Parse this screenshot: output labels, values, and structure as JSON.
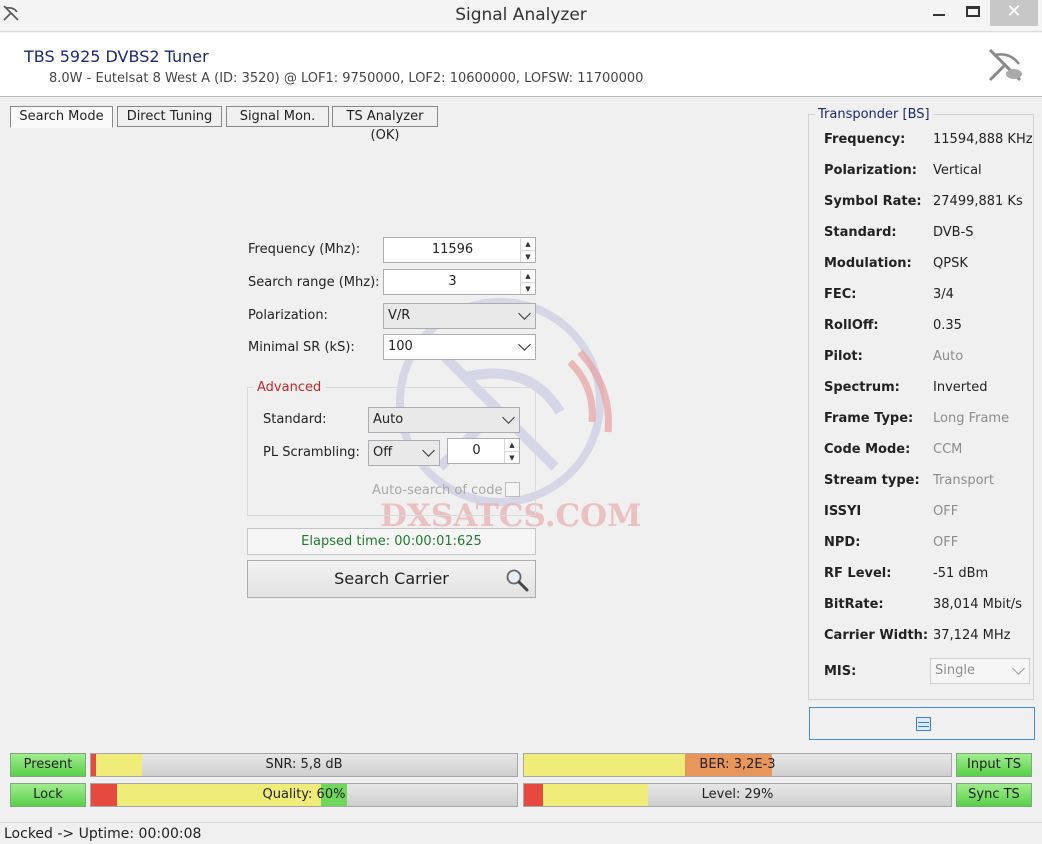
{
  "window": {
    "title": "Signal Analyzer",
    "close_glyph": "✕"
  },
  "header": {
    "tuner_name": "TBS 5925 DVBS2 Tuner",
    "satellite_info": "8.0W - Eutelsat 8 West A (ID: 3520) @ LOF1: 9750000, LOF2: 10600000, LOFSW: 11700000"
  },
  "tabs": [
    {
      "label": "Search Mode",
      "active": true
    },
    {
      "label": "Direct Tuning"
    },
    {
      "label": "Signal Mon."
    },
    {
      "label": "TS Analyzer (OK)"
    }
  ],
  "form": {
    "frequency_label": "Frequency (Mhz):",
    "frequency_value": "11596",
    "range_label": "Search range (Mhz):",
    "range_value": "3",
    "polarization_label": "Polarization:",
    "polarization_value": "V/R",
    "min_sr_label": "Minimal SR (kS):",
    "min_sr_value": "100"
  },
  "advanced": {
    "title": "Advanced",
    "standard_label": "Standard:",
    "standard_value": "Auto",
    "pls_label": "PL Scrambling:",
    "pls_value": "Off",
    "pls_code": "0",
    "auto_search_label": "Auto-search of code"
  },
  "elapsed": "Elapsed time: 00:00:01:625",
  "search_button": "Search Carrier",
  "watermark": "DXSATCS.COM",
  "transponder": {
    "title": "Transponder [BS]",
    "rows": [
      {
        "key": "Frequency:",
        "value": "11594,888 KHz"
      },
      {
        "key": "Polarization:",
        "value": "Vertical"
      },
      {
        "key": "Symbol Rate:",
        "value": "27499,881 Ks"
      },
      {
        "key": "Standard:",
        "value": "DVB-S"
      },
      {
        "key": "Modulation:",
        "value": "QPSK"
      },
      {
        "key": "FEC:",
        "value": "3/4"
      },
      {
        "key": "RollOff:",
        "value": "0.35"
      },
      {
        "key": "Pilot:",
        "value": "Auto"
      },
      {
        "key": "Spectrum:",
        "value": "Inverted"
      },
      {
        "key": "Frame Type:",
        "value": "Long Frame"
      },
      {
        "key": "Code Mode:",
        "value": "CCM"
      },
      {
        "key": "Stream type:",
        "value": "Transport"
      },
      {
        "key": "ISSYI",
        "value": "OFF"
      },
      {
        "key": "NPD:",
        "value": "OFF"
      },
      {
        "key": "RF Level:",
        "value": "-51 dBm"
      },
      {
        "key": "BitRate:",
        "value": "38,014 Mbit/s"
      },
      {
        "key": "Carrier Width:",
        "value": "37,124 MHz"
      }
    ],
    "mis_label": "MIS:",
    "mis_value": "Single"
  },
  "status": {
    "present": "Present",
    "lock": "Lock",
    "input_ts": "Input TS",
    "sync_ts": "Sync TS",
    "snr": "SNR: 5,8 dB",
    "snr_fraction": 0.12,
    "ber": "BER: 3,2E-3",
    "ber_fraction": 0.58,
    "quality": "Quality: 60%",
    "quality_fraction": 0.6,
    "level": "Level: 29%",
    "level_fraction": 0.29
  },
  "statusbar": "Locked -> Uptime: 00:00:08",
  "colors": {
    "accent": "#1b2a70",
    "advanced": "#c0282d",
    "elapsed": "#1f7a2d",
    "indicator": "#58d04a"
  }
}
